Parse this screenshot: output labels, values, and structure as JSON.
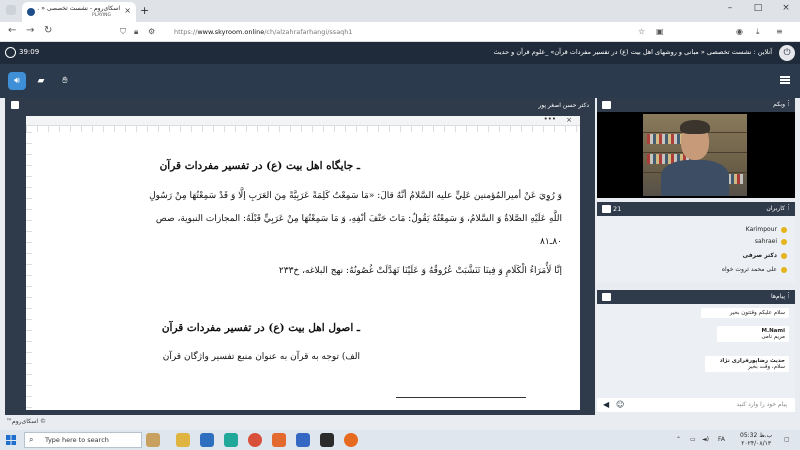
{
  "browser": {
    "tab_title": "اسکای‌روم - نشست تخصصی « ...",
    "tab_status": "PLAYING",
    "tab_close": "×",
    "new_tab": "+",
    "url_scheme": "https://",
    "url_host": "www.skyroom.online",
    "url_path": "/ch/alzahrafarhangi/ssaqh1",
    "window_controls": [
      "–",
      "□",
      "×"
    ]
  },
  "header": {
    "timer": "39:09",
    "title": "آنلاین : نشست تخصصی « مبانی و روشهای اهل بیت (ع) در تفسیر مفردات قرآن» _علوم قرآن و حدیث"
  },
  "presentation": {
    "presenter": "دکتر حسن اصغر پور",
    "menu_dots": "•••",
    "close": "×",
    "lines": [
      "ـ جایگاه اهل بیت (ع) در تفسیر مفردات قرآن",
      "وَ رُوِيَ عَنْ أميرالمُؤمنين عَلِيٍّ عليه السَّلامُ أنَّهُ قالَ: «مَا سَمِعْتُ كَلِمَةً عَرَبِيَّةً مِنَ العَرَبِ إلَّا وَ قَدْ سَمِعْتُهَا مِنْ رَسُولِ",
      "اللَّهِ عَلَيْهِ الصَّلاةُ وَ السَّلامُ، وَ سَمِعْتُهُ يَقُولُ: مَاتَ حَتْفَ أنْفِهِ، وَ مَا سَمِعْتُهَا مِنْ عَرَبِيٍّ قَبْلَهُ: المجازات النبوية، صص",
      "۸۰ـ۸۱",
      "إنَّا لَأُمَرَاءُ الْكَلَامِ وَ فِينَا تَنَشَّبَتْ عُرُوقُهُ وَ عَلَيْنَا تَهَدَّلَتْ غُصُونُهُ: نهج البلاغه، خ۲۳۳",
      "ـ اصول اهل بیت (ع) در تفسیر مفردات قرآن",
      "الف) توجه به قرآن به عنوان منبع تفسیر واژگان قرآن"
    ]
  },
  "webcam": {
    "title": "وبکم",
    "menu": "⋮"
  },
  "users": {
    "title": "کاربران",
    "count": "21",
    "menu": "⋮",
    "list": [
      "Karimpour",
      "sahraei",
      "دکتر صرفی",
      "علی محمد ثروت خواه"
    ]
  },
  "chat": {
    "title": "پیام‌ها",
    "menu": "⋮",
    "messages": [
      {
        "who": "",
        "text": "سلام علیکم وقتتون بخیر"
      },
      {
        "who": "M.Nami",
        "text": "مریم نامی"
      },
      {
        "who": "حدیث رضاپورفراری نژاد",
        "text": "سلام، وقت بخیر"
      }
    ],
    "placeholder": "پیام خود را وارد کنید"
  },
  "footer": {
    "copyright": "© اسکای‌روم™"
  },
  "taskbar": {
    "search_placeholder": "Type here to search",
    "lang": "FA",
    "time": "05:32 ب.ظ",
    "date": "۲۰۲۴/۰۸/۱۳"
  },
  "colors": {
    "header_bg": "#1f2b3a",
    "panel_bg": "#2f3b4b",
    "accent": "#3f8fd6"
  }
}
